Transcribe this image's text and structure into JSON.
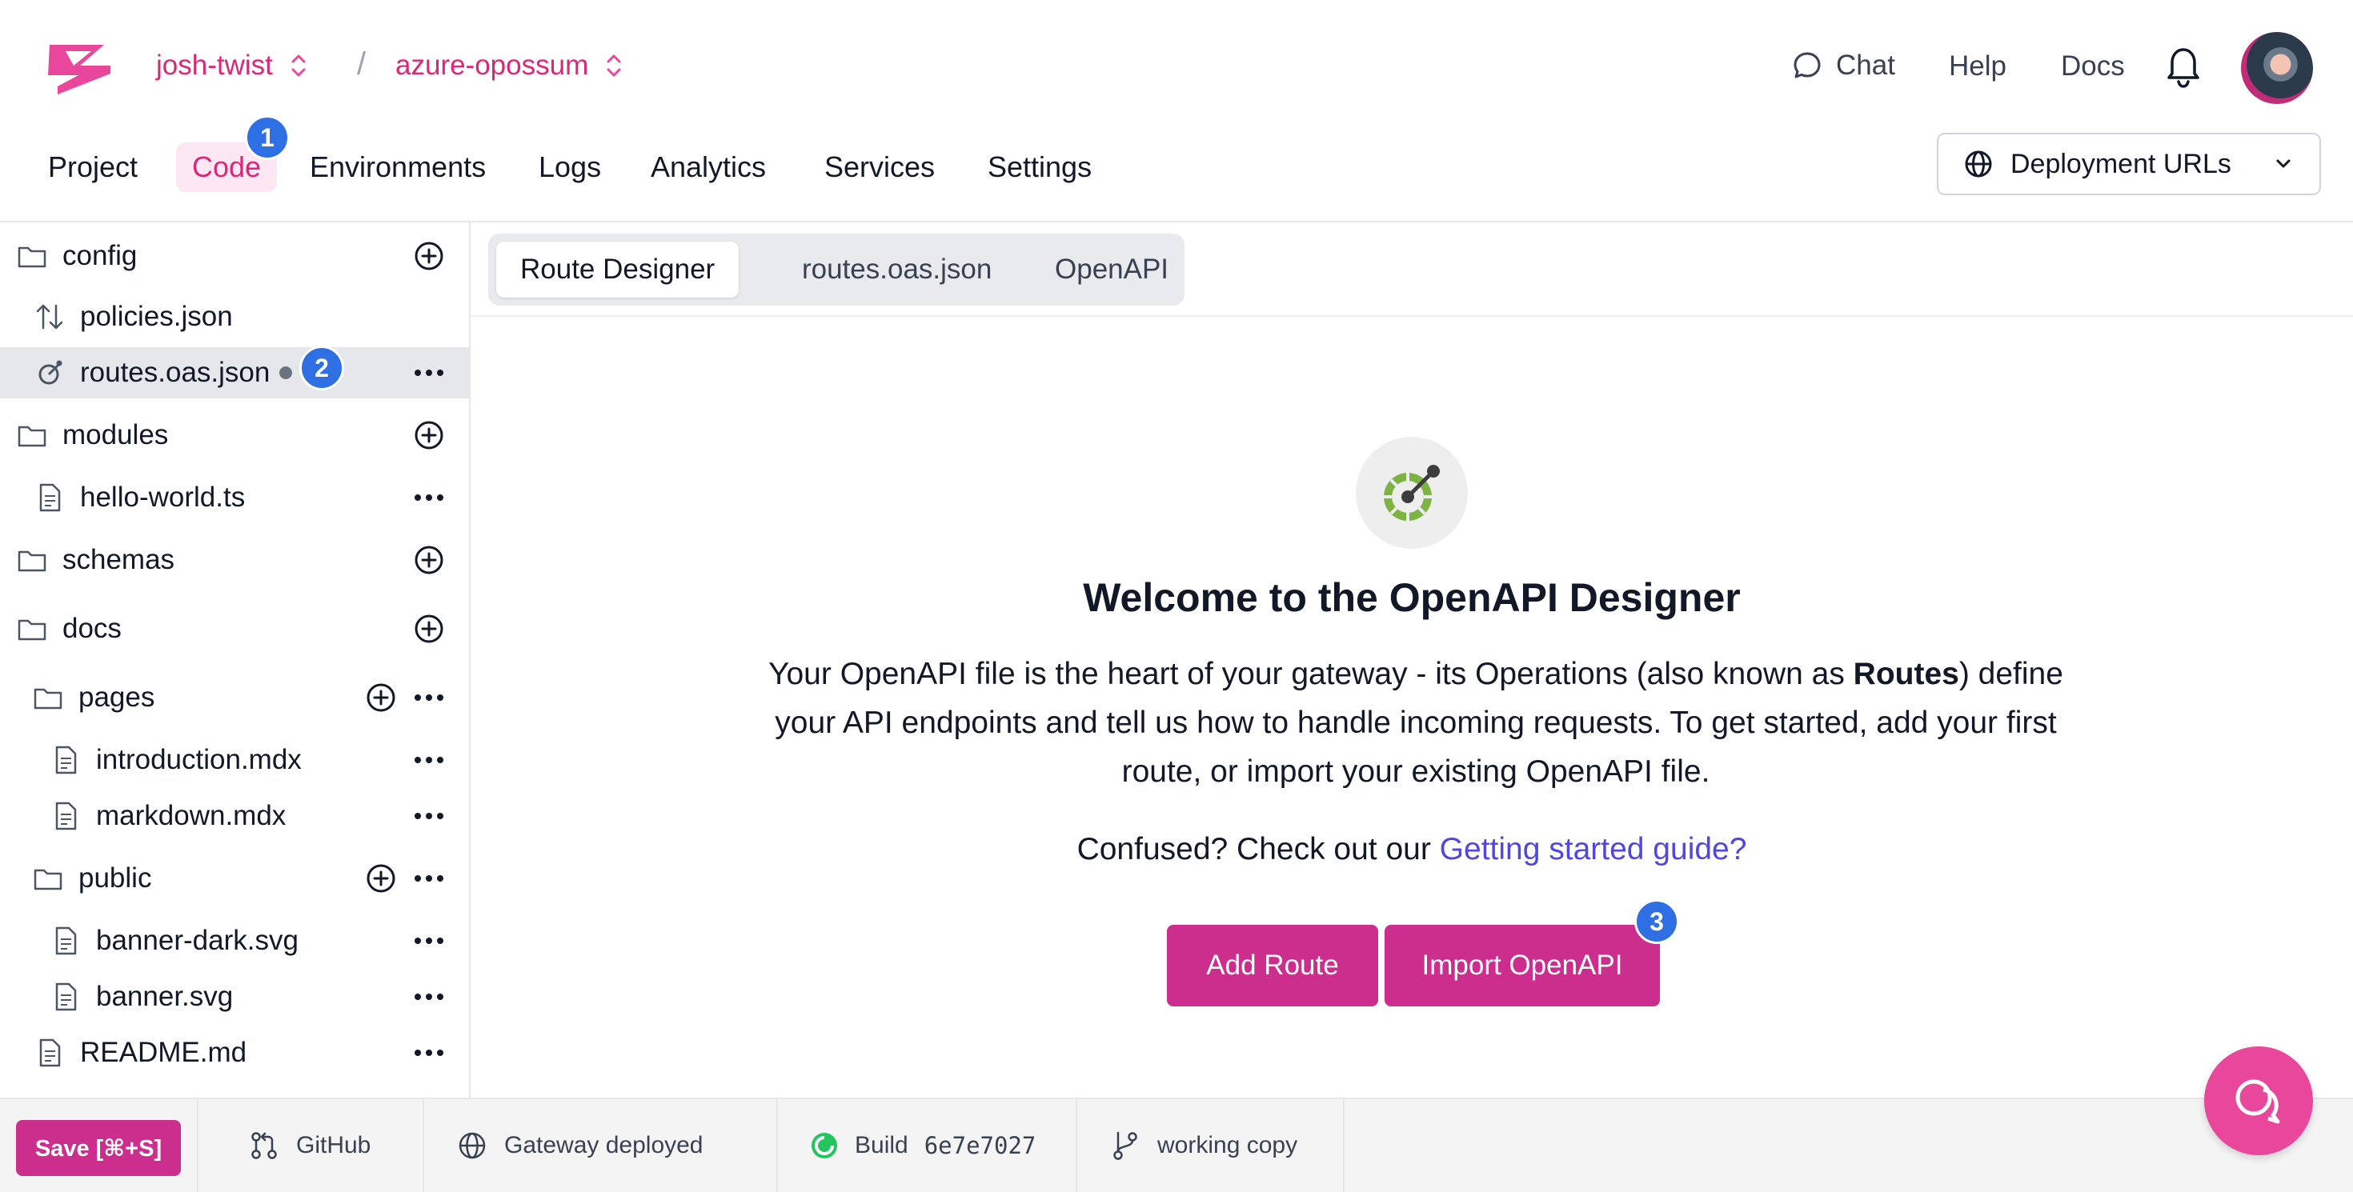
{
  "header": {
    "org": "josh-twist",
    "project": "azure-opossum",
    "separator": "/",
    "links": {
      "chat": "Chat",
      "help": "Help",
      "docs": "Docs"
    },
    "deployment_urls": "Deployment URLs"
  },
  "nav": {
    "items": [
      "Project",
      "Code",
      "Environments",
      "Logs",
      "Analytics",
      "Services",
      "Settings"
    ],
    "active": "Code"
  },
  "badges": {
    "one": "1",
    "two": "2",
    "three": "3"
  },
  "sidebar": {
    "config": "config",
    "policies": "policies.json",
    "routes": "routes.oas.json",
    "modules": "modules",
    "hello": "hello-world.ts",
    "schemas": "schemas",
    "docs": "docs",
    "pages": "pages",
    "intro": "introduction.mdx",
    "markdown": "markdown.mdx",
    "public": "public",
    "banner_dark": "banner-dark.svg",
    "banner": "banner.svg",
    "readme": "README.md"
  },
  "tabs": [
    "Route Designer",
    "routes.oas.json",
    "OpenAPI"
  ],
  "welcome": {
    "title": "Welcome to the OpenAPI Designer",
    "body_1": "Your OpenAPI file is the heart of your gateway - its Operations (also known as ",
    "body_bold": "Routes",
    "body_2": ") define your API endpoints and tell us how to handle incoming requests. To get started, add your first route, or import your existing OpenAPI file.",
    "confused": "Confused? Check out our ",
    "guide_link": "Getting started guide?",
    "add_route": "Add Route",
    "import_openapi": "Import OpenAPI"
  },
  "footer": {
    "save": "Save [⌘+S]",
    "github": "GitHub",
    "gateway": "Gateway deployed",
    "build_label": "Build",
    "build_hash": "6e7e7027",
    "working_copy": "working copy"
  },
  "colors": {
    "accent": "#db2777",
    "button": "#cc2e8e",
    "badge": "#2f6fe4",
    "link": "#4f46e5"
  },
  "icons": {
    "logo": "zuplo-logo",
    "chat": "chat-bubble-icon",
    "bell": "bell-icon",
    "globe": "globe-icon",
    "folder": "folder-icon",
    "file": "file-icon",
    "plus": "plus-circle-icon",
    "more": "more-dots-icon"
  }
}
